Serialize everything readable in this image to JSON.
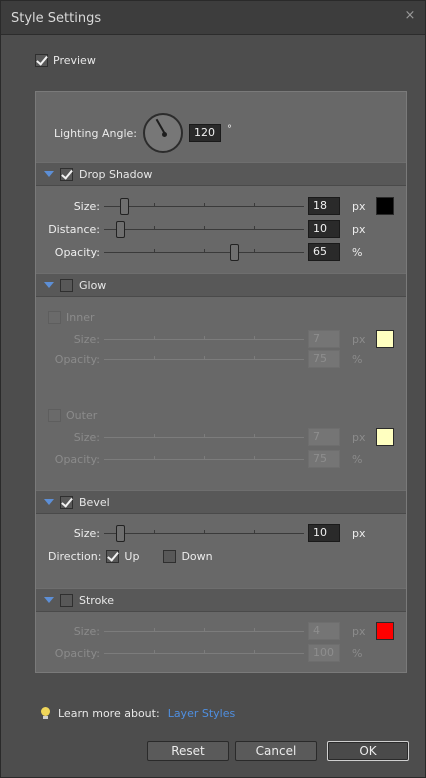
{
  "dialog": {
    "title": "Style Settings",
    "close_glyph": "×"
  },
  "preview": {
    "label": "Preview",
    "checked": true
  },
  "lighting": {
    "label": "Lighting Angle:",
    "value": "120",
    "unit": "°"
  },
  "drop_shadow": {
    "label": "Drop Shadow",
    "checked": true,
    "size": {
      "label": "Size:",
      "value": "18",
      "unit": "px",
      "level": 0.1
    },
    "distance": {
      "label": "Distance:",
      "value": "10",
      "unit": "px",
      "level": 0.08
    },
    "opacity": {
      "label": "Opacity:",
      "value": "65",
      "unit": "%",
      "level": 0.65
    },
    "color": "#000000"
  },
  "glow": {
    "label": "Glow",
    "checked": false,
    "inner": {
      "label": "Inner",
      "size": {
        "label": "Size:",
        "value": "7",
        "unit": "px"
      },
      "opacity": {
        "label": "Opacity:",
        "value": "75",
        "unit": "%"
      },
      "color": "#ffffc0"
    },
    "outer": {
      "label": "Outer",
      "size": {
        "label": "Size:",
        "value": "7",
        "unit": "px"
      },
      "opacity": {
        "label": "Opacity:",
        "value": "75",
        "unit": "%"
      },
      "color": "#ffffc0"
    }
  },
  "bevel": {
    "label": "Bevel",
    "checked": true,
    "size": {
      "label": "Size:",
      "value": "10",
      "unit": "px",
      "level": 0.08
    },
    "direction_label": "Direction:",
    "up_label": "Up",
    "down_label": "Down",
    "up_checked": true
  },
  "stroke": {
    "label": "Stroke",
    "checked": false,
    "size": {
      "label": "Size:",
      "value": "4",
      "unit": "px"
    },
    "opacity": {
      "label": "Opacity:",
      "value": "100",
      "unit": "%"
    },
    "color": "#ff0000"
  },
  "learn": {
    "label": "Learn more about:",
    "link": "Layer Styles"
  },
  "buttons": {
    "reset": "Reset",
    "cancel": "Cancel",
    "ok": "OK"
  },
  "colors": {
    "accent_link": "#4f8fe0",
    "disclosure": "#5d8fd6"
  }
}
